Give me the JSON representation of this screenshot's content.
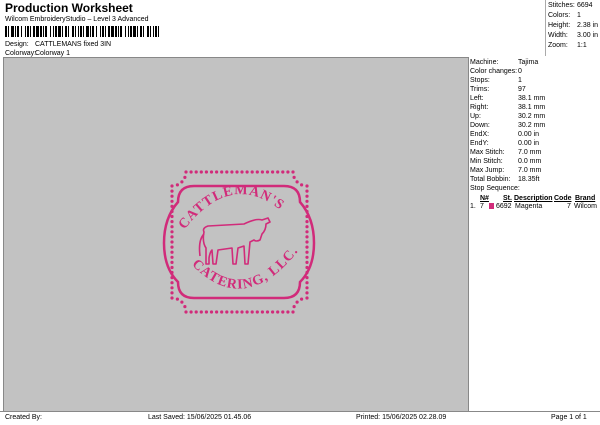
{
  "header": {
    "title": "Production Worksheet",
    "subtitle": "Wilcom EmbroideryStudio – Level 3 Advanced",
    "design_label": "Design:",
    "design_value": "CATTLEMANS fixed 3IN",
    "colorway_label": "Colorway:",
    "colorway_value": "Colorway 1"
  },
  "summary": [
    {
      "label": "Stitches:",
      "value": "6694"
    },
    {
      "label": "Colors:",
      "value": "1"
    },
    {
      "label": "Height:",
      "value": "2.38 in"
    },
    {
      "label": "Width:",
      "value": "3.00 in"
    },
    {
      "label": "Zoom:",
      "value": "1:1"
    }
  ],
  "design_image": {
    "top_text": "CATTLEMAN'S",
    "bottom_text": "CATERING, LLC.",
    "thread_color": "#d12b7a"
  },
  "specs": [
    {
      "label": "Machine:",
      "value": "Tajima"
    },
    {
      "label": "Color changes:",
      "value": "0"
    },
    {
      "label": "Stops:",
      "value": "1"
    },
    {
      "label": "Trims:",
      "value": "97"
    },
    {
      "label": "Left:",
      "value": "38.1 mm"
    },
    {
      "label": "Right:",
      "value": "38.1 mm"
    },
    {
      "label": "Up:",
      "value": "30.2 mm"
    },
    {
      "label": "Down:",
      "value": "30.2 mm"
    },
    {
      "label": "EndX:",
      "value": "0.00 in"
    },
    {
      "label": "EndY:",
      "value": "0.00 in"
    },
    {
      "label": "Max Stitch:",
      "value": "7.0 mm"
    },
    {
      "label": "Min Stitch:",
      "value": "0.0 mm"
    },
    {
      "label": "Max Jump:",
      "value": "7.0 mm"
    },
    {
      "label": "Total Bobbin:",
      "value": "18.35ft"
    }
  ],
  "stop_sequence": {
    "title": "Stop Sequence:",
    "columns": [
      "N#",
      "St.",
      "Description",
      "Code",
      "Brand"
    ],
    "rows": [
      {
        "n": "1.",
        "needle": "7",
        "stitches": "6692",
        "description": "Magenta",
        "code": "7",
        "brand": "Wilcom"
      }
    ]
  },
  "footer": {
    "created_by": "Created By:",
    "last_saved": "Last Saved: 15/06/2025 01.45.06",
    "printed": "Printed: 15/06/2025 02.28.09",
    "page": "Page 1 of 1"
  }
}
